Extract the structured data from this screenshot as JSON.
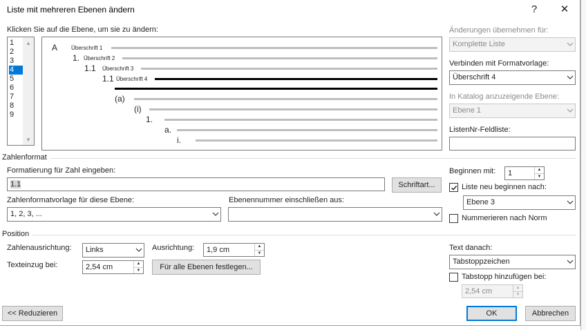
{
  "dialog": {
    "title": "Liste mit mehreren Ebenen ändern",
    "help_glyph": "?",
    "close_glyph": "✕"
  },
  "levels": {
    "label": "Klicken Sie auf die Ebene, um sie zu ändern:",
    "items": [
      "1",
      "2",
      "3",
      "4",
      "5",
      "6",
      "7",
      "8",
      "9"
    ],
    "selected": "4"
  },
  "preview": {
    "rows": [
      {
        "num": "A",
        "label": "Überschrift 1"
      },
      {
        "num": "1.",
        "label": "Überschrift 2"
      },
      {
        "num": "1.1",
        "label": "Überschrift 3"
      },
      {
        "num": "1.1",
        "label": "Überschrift 4"
      },
      {
        "num": "(a)",
        "label": ""
      },
      {
        "num": "(i)",
        "label": ""
      },
      {
        "num": "1.",
        "label": ""
      },
      {
        "num": "a.",
        "label": ""
      },
      {
        "num": "i.",
        "label": ""
      }
    ]
  },
  "right_panel": {
    "apply_label": "Änderungen übernehmen für:",
    "apply_value": "Komplette Liste",
    "link_label": "Verbinden mit Formatvorlage:",
    "link_value": "Überschrift 4",
    "gallery_label": "In Katalog anzuzeigende Ebene:",
    "gallery_value": "Ebene 1",
    "listnum_label": "ListenNr-Feldliste:",
    "listnum_value": ""
  },
  "number_format": {
    "section": "Zahlenformat",
    "format_label": "Formatierung für Zahl eingeben:",
    "format_value": "1.1",
    "font_button": "Schriftart...",
    "style_label": "Zahlenformatvorlage für diese Ebene:",
    "style_value": "1, 2, 3, ...",
    "include_label": "Ebenennummer einschließen aus:",
    "include_value": "",
    "start_label": "Beginnen mit:",
    "start_value": "1",
    "restart_label": "Liste neu beginnen nach:",
    "restart_checked": true,
    "restart_value": "Ebene 3",
    "legal_label": "Nummerieren nach Norm",
    "legal_checked": false
  },
  "position": {
    "section": "Position",
    "align_label": "Zahlenausrichtung:",
    "align_value": "Links",
    "at_label": "Ausrichtung:",
    "at_value": "1,9 cm",
    "indent_label": "Texteinzug bei:",
    "indent_value": "2,54 cm",
    "set_all_button": "Für alle Ebenen festlegen...",
    "follow_label": "Text danach:",
    "follow_value": "Tabstoppzeichen",
    "tabstop_label": "Tabstopp hinzufügen bei:",
    "tabstop_checked": false,
    "tabstop_value": "2,54 cm"
  },
  "footer": {
    "less_button": "<< Reduzieren",
    "ok_button": "OK",
    "cancel_button": "Abbrechen"
  },
  "colors": {
    "selection": "#0078d7",
    "primary_border": "#0078d7"
  }
}
